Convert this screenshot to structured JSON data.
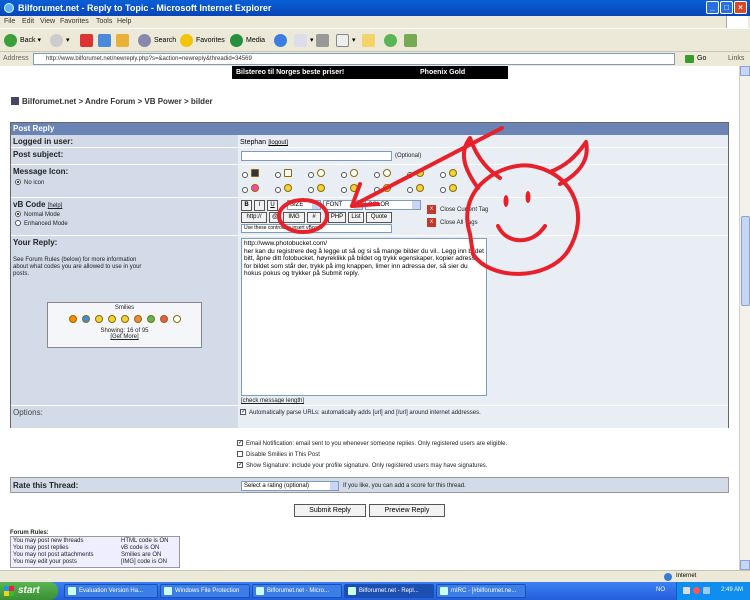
{
  "window": {
    "title": "Bilforumet.net - Reply to Topic - Microsoft Internet Explorer"
  },
  "menu": [
    "File",
    "Edit",
    "View",
    "Favorites",
    "Tools",
    "Help"
  ],
  "toolbar": {
    "back": "Back",
    "search": "Search",
    "favorites": "Favorites",
    "media": "Media"
  },
  "address": {
    "label": "Address",
    "url": "http://www.bilforumet.net/newreply.php?s=&action=newreply&threadid=34569",
    "go": "Go",
    "links": "Links"
  },
  "banner": {
    "left": "Bilstereo til Norges beste priser!",
    "right": "Phoenix Gold"
  },
  "breadcrumb": "Bilforumet.net > Andre Forum > VB Power > bilder",
  "form": {
    "header": "Post Reply",
    "logged_in_label": "Logged in user:",
    "logged_in_value": "Stephan",
    "logout": "[logout]",
    "subject_label": "Post subject:",
    "subject_hint": "(Optional)",
    "icon_label": "Message Icon:",
    "no_icon": "No icon",
    "vbcode_label": "vB Code",
    "vbcode_help": "[help]",
    "normal_mode": "Normal Mode",
    "enhanced_mode": "Enhanced Mode",
    "code_buttons": [
      "B",
      "I",
      "U",
      "SIZE",
      "FONT",
      "COLOR",
      "http://",
      "@",
      "IMG",
      "#",
      "PHP",
      "List",
      "Quote"
    ],
    "size_sel": "SIZE",
    "font_sel": "FONT",
    "color_sel": "COLOR",
    "close_current": "Close Current Tag",
    "close_all": "Close All Tags",
    "hint_box": "Use these controls to insert vBcode",
    "reply_label": "Your Reply:",
    "rules_text": "See Forum Rules (below) for more information about what codes you are allowed to use in your posts.",
    "smilies_title": "Smilies",
    "smilies_showing": "Showing: 16 of 95",
    "get_more": "[Get More]",
    "reply_text": "http://www.photobucket.com/\nher kan du registrere deg å legge ut så og si så mange bilder du vil.. Legg inn bildet bitt, åpne ditt fotobucket, høyreklikk på bildet og trykk egenskaper, kopier adressa for bildet som står der, trykk på img knappen, limer inn adressa der, så sier du hokus pokus og trykker på Submit reply.",
    "check_length": "[check message length]",
    "options_label": "Options:",
    "opt1": "Automatically parse URLs: automatically adds [url] and [/url] around internet addresses.",
    "opt2": "Email Notification: email sent to you whenever someone replies. Only registered users are eligible.",
    "opt3": "Disable Smilies in This Post",
    "opt4": "Show Signature: include your profile signature. Only registered users may have signatures.",
    "rate_label": "Rate this Thread:",
    "rate_select": "Select a rating (optional)",
    "rate_hint": "If you like, you can add a score for this thread.",
    "submit": "Submit Reply",
    "preview": "Preview Reply"
  },
  "rules": {
    "title": "Forum Rules:",
    "rows": [
      [
        "You may post new threads",
        "HTML code is ON"
      ],
      [
        "You may post replies",
        "vB code is ON"
      ],
      [
        "You may not post attachments",
        "Smilies are ON"
      ],
      [
        "You may edit your posts",
        "[IMG] code is ON"
      ]
    ]
  },
  "statusbar": {
    "zone": "Internet"
  },
  "taskbar": {
    "start": "start",
    "tasks": [
      "Evaluation Version Ha...",
      "Windows File Protection",
      "Bilforumet.net - Micro...",
      "Bilforumet.net - Repl...",
      "mIRC - [#bilforumet.ne..."
    ],
    "lang": "NO",
    "time": "2:49 AM"
  },
  "colors": {
    "annotation": "#e8202a",
    "form_header": "#6b84b6"
  }
}
